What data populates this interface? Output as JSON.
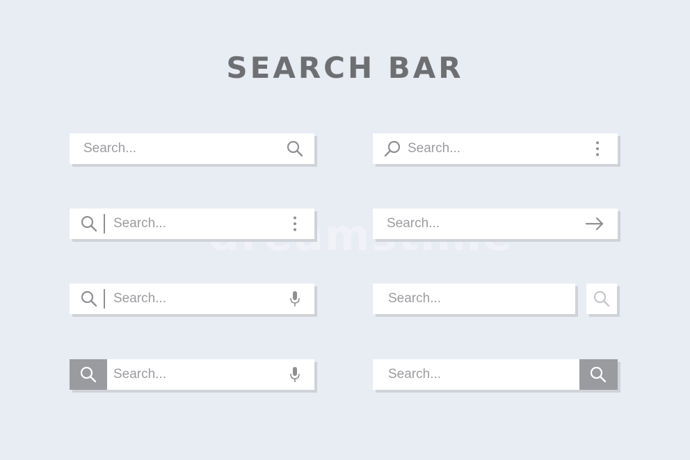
{
  "title": "SEARCH BAR",
  "watermark": "dreamstime",
  "colors": {
    "background": "#e8ecf3",
    "bar": "#ffffff",
    "shadow": "#cfd2d7",
    "text": "#9b9ca0",
    "title": "#6e6f73",
    "button": "#9a9b9f"
  },
  "bars": [
    {
      "placeholder": "Search...",
      "icons": [
        "search-icon"
      ]
    },
    {
      "placeholder": "Search...",
      "icons": [
        "search-icon",
        "kebab-menu-icon"
      ]
    },
    {
      "placeholder": "Search...",
      "icons": [
        "search-icon",
        "kebab-menu-icon"
      ]
    },
    {
      "placeholder": "Search...",
      "icons": [
        "arrow-right-icon"
      ]
    },
    {
      "placeholder": "Search...",
      "icons": [
        "search-icon",
        "microphone-icon"
      ]
    },
    {
      "placeholder": "Search...",
      "icons": [
        "search-icon"
      ]
    },
    {
      "placeholder": "Search...",
      "icons": [
        "search-icon",
        "microphone-icon"
      ]
    },
    {
      "placeholder": "Search...",
      "icons": [
        "search-icon"
      ]
    }
  ]
}
